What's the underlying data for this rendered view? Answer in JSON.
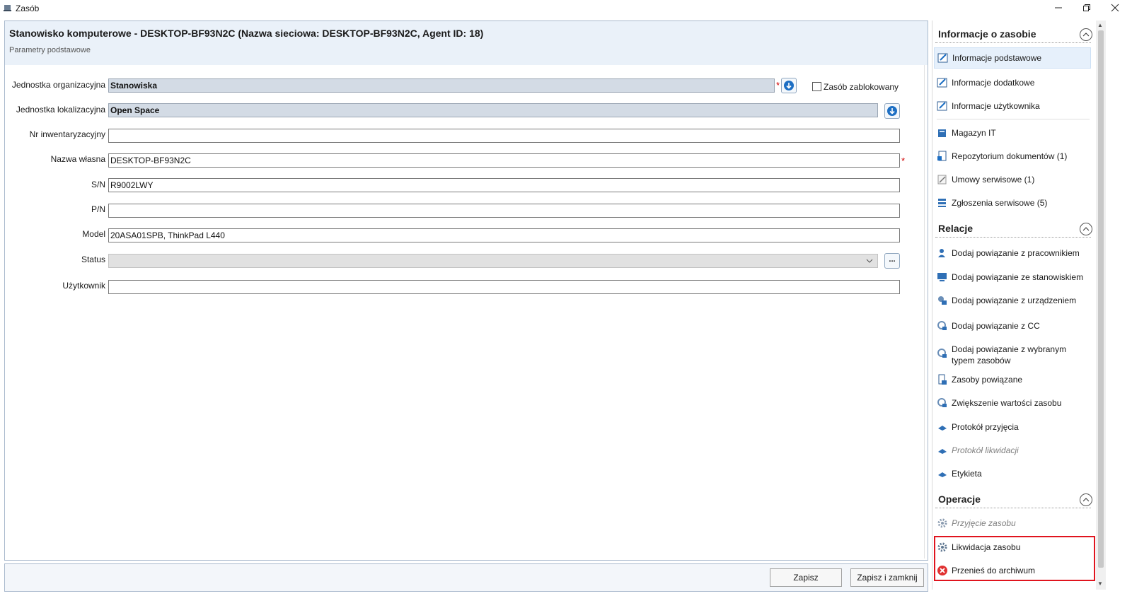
{
  "window": {
    "title": "Zasób",
    "minimize_icon": "minimize-icon",
    "restore_icon": "restore-icon",
    "close_icon": "close-icon"
  },
  "form": {
    "title": "Stanowisko komputerowe - DESKTOP-BF93N2C (Nazwa sieciowa: DESKTOP-BF93N2C, Agent ID: 18)",
    "subtitle": "Parametry podstawowe",
    "fields": {
      "org_unit": {
        "label": "Jednostka organizacyjna",
        "value": "Stanowiska",
        "required": true
      },
      "blocked": {
        "label": "Zasób zablokowany",
        "checked": false
      },
      "loc_unit": {
        "label": "Jednostka lokalizacyjna",
        "value": "Open Space"
      },
      "inventory_no": {
        "label": "Nr inwentaryzacyjny",
        "value": ""
      },
      "own_name": {
        "label": "Nazwa własna",
        "value": "DESKTOP-BF93N2C",
        "required": true
      },
      "sn": {
        "label": "S/N",
        "value": "R9002LWY"
      },
      "pn": {
        "label": "P/N",
        "value": ""
      },
      "model": {
        "label": "Model",
        "value": "20ASA01SPB, ThinkPad L440"
      },
      "status": {
        "label": "Status",
        "value": "",
        "more_label": "..."
      },
      "user": {
        "label": "Użytkownik",
        "value": ""
      }
    },
    "required_marker": "*"
  },
  "buttons": {
    "save": "Zapisz",
    "save_close": "Zapisz i zamknij"
  },
  "sidebar": {
    "sections": [
      {
        "title": "Informacje o zasobie",
        "items": [
          {
            "label": "Informacje podstawowe",
            "icon": "edit-info-icon",
            "active": true
          },
          {
            "label": "Informacje dodatkowe",
            "icon": "edit-info-icon"
          },
          {
            "label": "Informacje użytkownika",
            "icon": "edit-info-icon"
          },
          {
            "label": "Magazyn IT",
            "icon": "warehouse-icon"
          },
          {
            "label": "Repozytorium dokumentów (1)",
            "icon": "documents-icon"
          },
          {
            "label": "Umowy serwisowe (1)",
            "icon": "contract-icon"
          },
          {
            "label": "Zgłoszenia serwisowe (5)",
            "icon": "tickets-icon"
          }
        ]
      },
      {
        "title": "Relacje",
        "items": [
          {
            "label": "Dodaj powiązanie z pracownikiem",
            "icon": "user-link-icon"
          },
          {
            "label": "Dodaj powiązanie ze stanowiskiem",
            "icon": "workstation-link-icon"
          },
          {
            "label": "Dodaj powiązanie z urządzeniem",
            "icon": "device-link-icon"
          },
          {
            "label": "Dodaj powiązanie z CC",
            "icon": "cc-link-icon"
          },
          {
            "label": "Dodaj powiązanie z wybranym typem zasobów",
            "icon": "resource-link-icon"
          },
          {
            "label": "Zasoby powiązane",
            "icon": "linked-resources-icon"
          },
          {
            "label": "Zwiększenie wartości zasobu",
            "icon": "value-increase-icon"
          },
          {
            "label": "Protokół przyjęcia",
            "icon": "protocol-icon"
          },
          {
            "label": "Protokół likwidacji",
            "icon": "protocol-icon",
            "disabled": true
          },
          {
            "label": "Etykieta",
            "icon": "label-icon"
          }
        ]
      },
      {
        "title": "Operacje",
        "items": [
          {
            "label": "Przyjęcie zasobu",
            "icon": "gear-icon",
            "disabled": true
          },
          {
            "label": "Likwidacja zasobu",
            "icon": "gear-icon"
          },
          {
            "label": "Przenieś do archiwum",
            "icon": "archive-remove-icon"
          }
        ]
      }
    ]
  },
  "colors": {
    "header_band": "#eaf1f9",
    "gray_field": "#d3dbe5",
    "highlight": "#e0141e",
    "required": "#d00000"
  }
}
